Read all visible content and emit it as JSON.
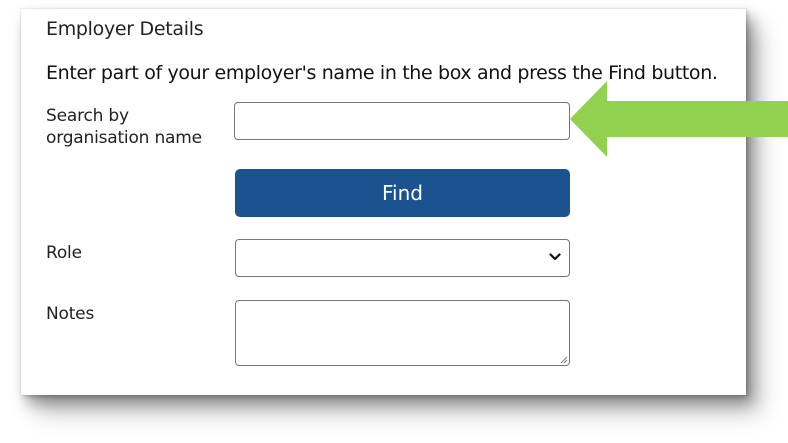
{
  "form": {
    "heading": "Employer Details",
    "instructions": "Enter part of your employer's name in the box and press the Find button.",
    "search": {
      "label": "Search by organisation name",
      "value": "",
      "placeholder": ""
    },
    "find_button_label": "Find",
    "role": {
      "label": "Role",
      "selected": ""
    },
    "notes": {
      "label": "Notes",
      "value": ""
    }
  },
  "icons": {
    "callout": "arrow-left-icon",
    "select": "chevron-down-icon",
    "textarea": "resize-handle-icon"
  },
  "colors": {
    "find_button": "#1b5391",
    "find_button_text": "#ffffff",
    "arrow": "#92d050",
    "input_border": "#767676"
  }
}
